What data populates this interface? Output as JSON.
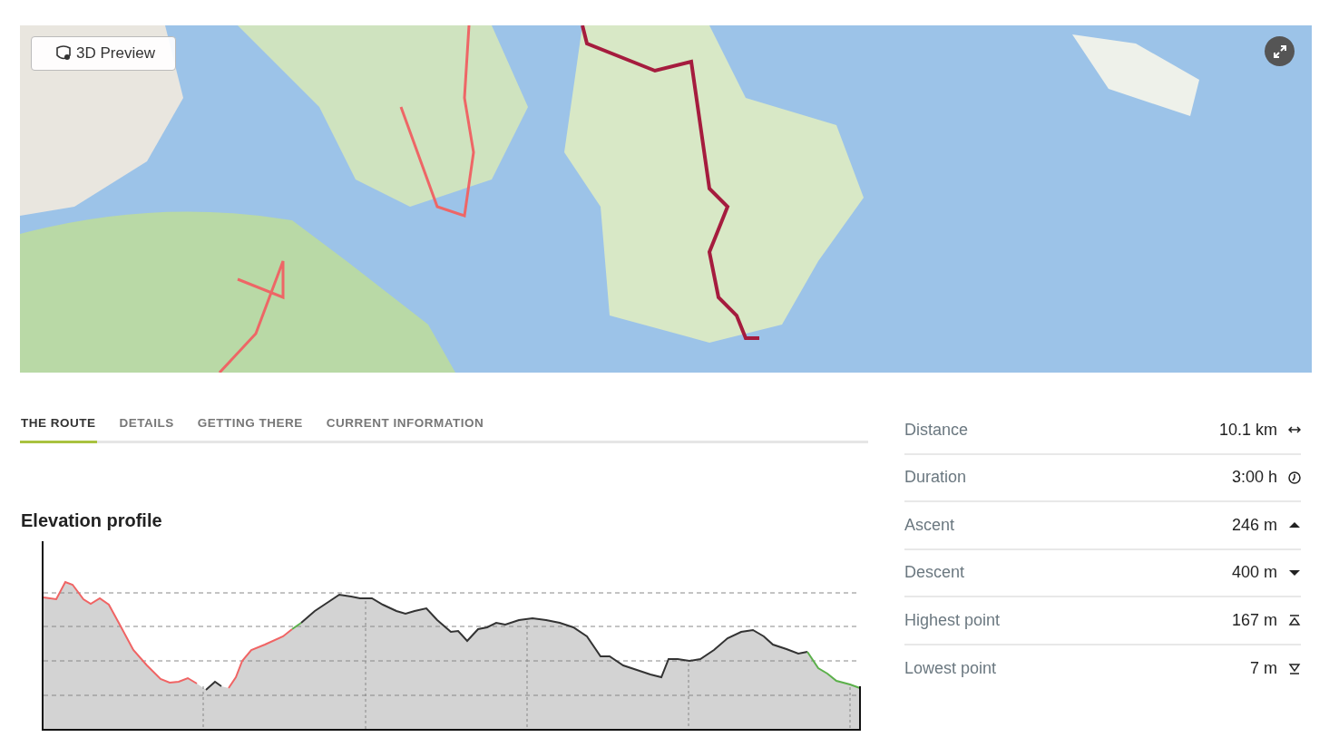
{
  "map": {
    "preview_button": "3D Preview"
  },
  "tabs": [
    {
      "label": "THE ROUTE",
      "selected": true
    },
    {
      "label": "DETAILS",
      "selected": false
    },
    {
      "label": "GETTING THERE",
      "selected": false
    },
    {
      "label": "CURRENT INFORMATION",
      "selected": false
    }
  ],
  "elevation": {
    "title": "Elevation profile"
  },
  "stats": [
    {
      "kind": "distance",
      "label": "Distance",
      "value": "10.1 km"
    },
    {
      "kind": "duration",
      "label": "Duration",
      "value": "3:00 h"
    },
    {
      "kind": "ascent",
      "label": "Ascent",
      "value": "246 m"
    },
    {
      "kind": "descent",
      "label": "Descent",
      "value": "400 m"
    },
    {
      "kind": "highest",
      "label": "Highest point",
      "value": "167 m"
    },
    {
      "kind": "lowest",
      "label": "Lowest point",
      "value": "7 m"
    }
  ]
}
